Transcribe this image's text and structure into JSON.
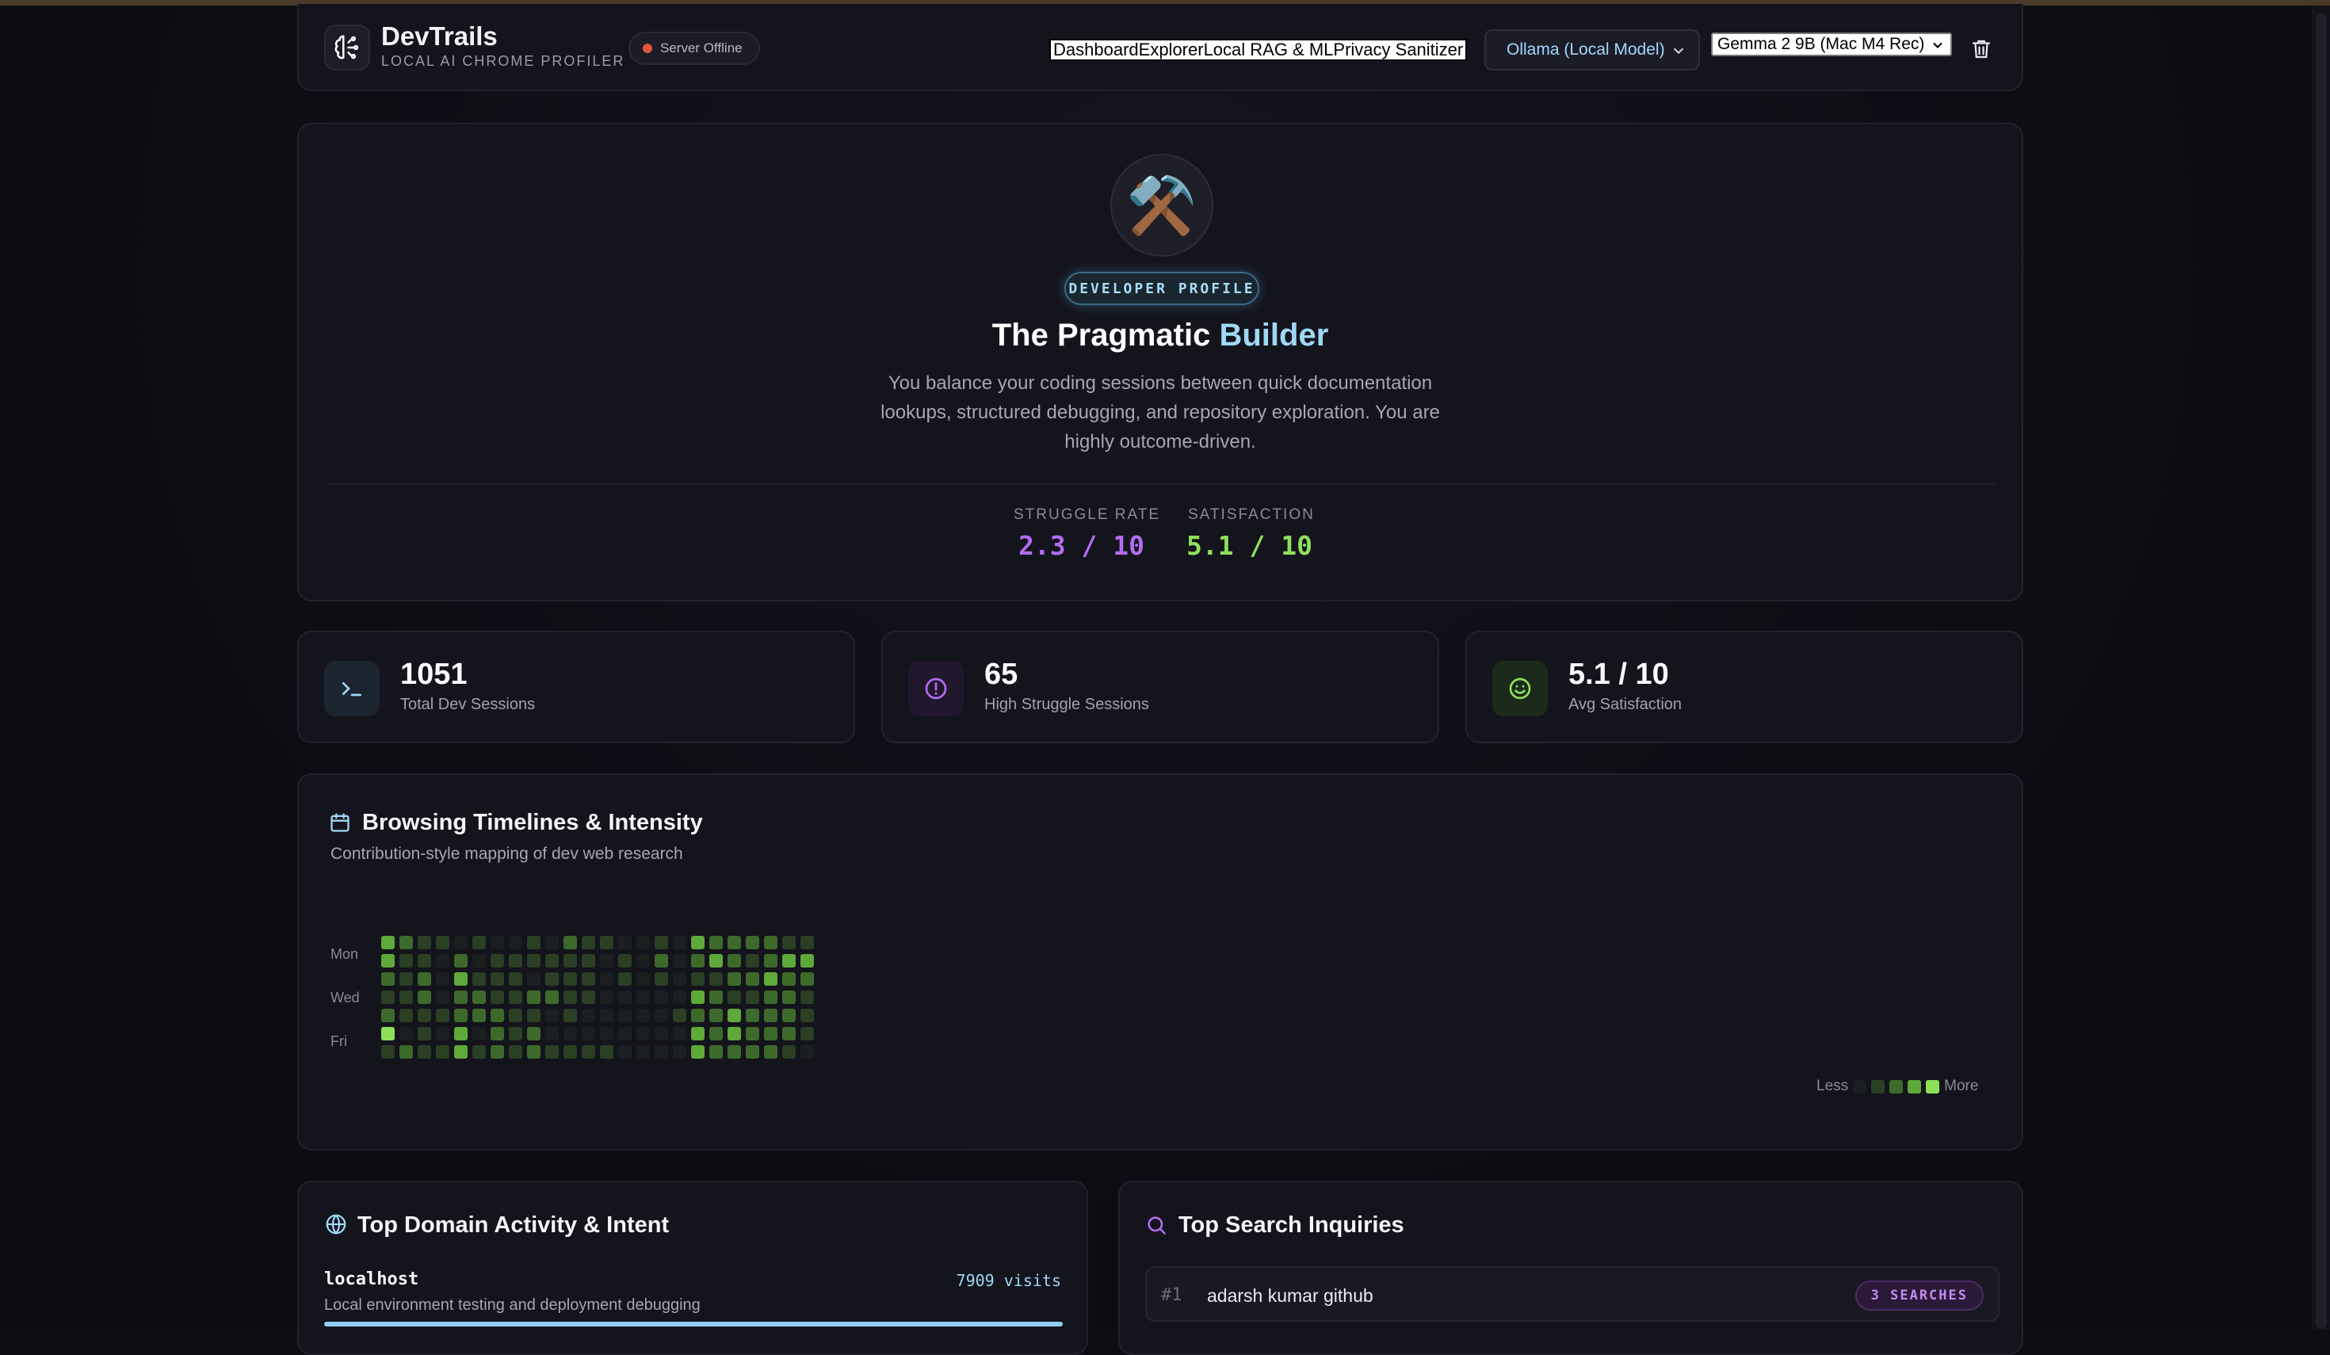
{
  "header": {
    "brand_title": "DevTrails",
    "brand_subtitle": "LOCAL AI CHROME PROFILER",
    "server_status": "Server Offline",
    "nav": [
      "Dashboard",
      "Explorer",
      "Local RAG & ML",
      "Privacy Sanitizer"
    ],
    "provider_select": "Ollama (Local Model)",
    "model_select": "Gemma 2 9B (Mac M4 Rec)"
  },
  "profile": {
    "avatar_emoji": "⚒️",
    "badge": "DEVELOPER PROFILE",
    "title_main": "The Pragmatic ",
    "title_accent": "Builder",
    "description": "You balance your coding sessions between quick documentation lookups, structured debugging, and repository exploration. You are highly outcome-driven.",
    "struggle_label": "STRUGGLE RATE",
    "struggle_value": "2.3 / 10",
    "satisfaction_label": "SATISFACTION",
    "satisfaction_value": "5.1 / 10"
  },
  "stats": [
    {
      "value": "1051",
      "label": "Total Dev Sessions",
      "icon": "terminal-icon"
    },
    {
      "value": "65",
      "label": "High Struggle Sessions",
      "icon": "alert-circle-icon"
    },
    {
      "value": "5.1 / 10",
      "label": "Avg Satisfaction",
      "icon": "smile-icon"
    }
  ],
  "timeline": {
    "title": "Browsing Timelines & Intensity",
    "subtitle": "Contribution-style mapping of dev web research",
    "day_labels": [
      "Mon",
      "Wed",
      "Fri"
    ],
    "legend_less": "Less",
    "legend_more": "More",
    "levels": [
      [
        3,
        2,
        1,
        1,
        0,
        1,
        0,
        0,
        1,
        0,
        2,
        1,
        1,
        0,
        0,
        1,
        0,
        3,
        2,
        2,
        2,
        2,
        1,
        1
      ],
      [
        3,
        1,
        1,
        0,
        2,
        0,
        1,
        1,
        1,
        1,
        1,
        1,
        0,
        1,
        0,
        2,
        0,
        2,
        3,
        2,
        1,
        2,
        3,
        3
      ],
      [
        2,
        1,
        2,
        0,
        3,
        1,
        1,
        1,
        0,
        1,
        1,
        1,
        0,
        1,
        0,
        1,
        0,
        1,
        1,
        2,
        2,
        3,
        2,
        2
      ],
      [
        1,
        1,
        2,
        0,
        2,
        2,
        1,
        1,
        2,
        2,
        1,
        1,
        0,
        0,
        0,
        0,
        0,
        3,
        2,
        1,
        1,
        2,
        2,
        1
      ],
      [
        2,
        1,
        1,
        1,
        2,
        2,
        2,
        1,
        1,
        0,
        1,
        0,
        0,
        0,
        0,
        0,
        1,
        2,
        2,
        3,
        2,
        2,
        2,
        1
      ],
      [
        4,
        0,
        1,
        0,
        3,
        0,
        2,
        1,
        2,
        0,
        0,
        0,
        0,
        0,
        0,
        0,
        0,
        3,
        2,
        3,
        2,
        2,
        2,
        1
      ],
      [
        1,
        2,
        1,
        1,
        3,
        1,
        2,
        1,
        2,
        1,
        1,
        1,
        1,
        0,
        0,
        0,
        0,
        3,
        2,
        2,
        2,
        2,
        1,
        0
      ]
    ]
  },
  "domains": {
    "title": "Top Domain Activity & Intent",
    "top": {
      "name": "localhost",
      "visits": "7909 visits",
      "description": "Local environment testing and deployment debugging",
      "share": 1.0
    }
  },
  "searches": {
    "title": "Top Search Inquiries",
    "top": {
      "rank": "#1",
      "query": "adarsh kumar github",
      "count": "3 SEARCHES"
    }
  },
  "colors": {
    "heat": [
      "#1b1f20",
      "#2a3f24",
      "#3d6a2a",
      "#5fa83a",
      "#8ee05a"
    ],
    "struggle": "#b26cf2",
    "satisfaction": "#8ee05a"
  }
}
